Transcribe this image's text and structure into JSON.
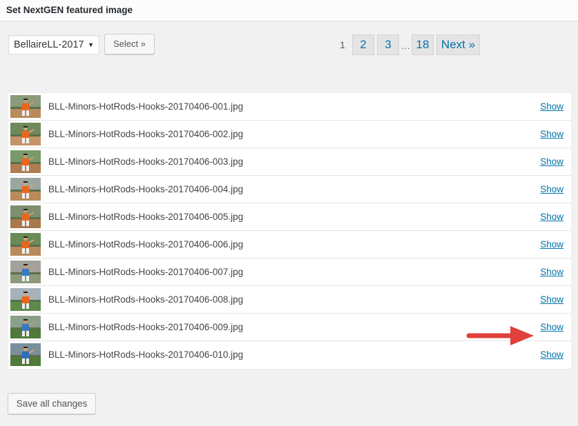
{
  "dialog": {
    "title": "Set NextGEN featured image"
  },
  "toolbar": {
    "gallery_selected": "BellaireLL-2017",
    "select_label": "Select »"
  },
  "pagination": {
    "current": "1",
    "pages": [
      "2",
      "3"
    ],
    "ellipsis": "…",
    "last": "18",
    "next_label": "Next »"
  },
  "images": [
    {
      "filename": "BLL-Minors-HotRods-Hooks-20170406-001.jpg",
      "action": "Show"
    },
    {
      "filename": "BLL-Minors-HotRods-Hooks-20170406-002.jpg",
      "action": "Show"
    },
    {
      "filename": "BLL-Minors-HotRods-Hooks-20170406-003.jpg",
      "action": "Show"
    },
    {
      "filename": "BLL-Minors-HotRods-Hooks-20170406-004.jpg",
      "action": "Show"
    },
    {
      "filename": "BLL-Minors-HotRods-Hooks-20170406-005.jpg",
      "action": "Show"
    },
    {
      "filename": "BLL-Minors-HotRods-Hooks-20170406-006.jpg",
      "action": "Show"
    },
    {
      "filename": "BLL-Minors-HotRods-Hooks-20170406-007.jpg",
      "action": "Show"
    },
    {
      "filename": "BLL-Minors-HotRods-Hooks-20170406-008.jpg",
      "action": "Show"
    },
    {
      "filename": "BLL-Minors-HotRods-Hooks-20170406-009.jpg",
      "action": "Show"
    },
    {
      "filename": "BLL-Minors-HotRods-Hooks-20170406-010.jpg",
      "action": "Show"
    }
  ],
  "footer": {
    "save_label": "Save all changes"
  },
  "colors": {
    "link": "#0073aa",
    "annotation_arrow": "#e0413a",
    "jersey_orange": "#e8661e",
    "field_green": "#4f7a3a",
    "dirt_brown": "#b98a5a"
  }
}
